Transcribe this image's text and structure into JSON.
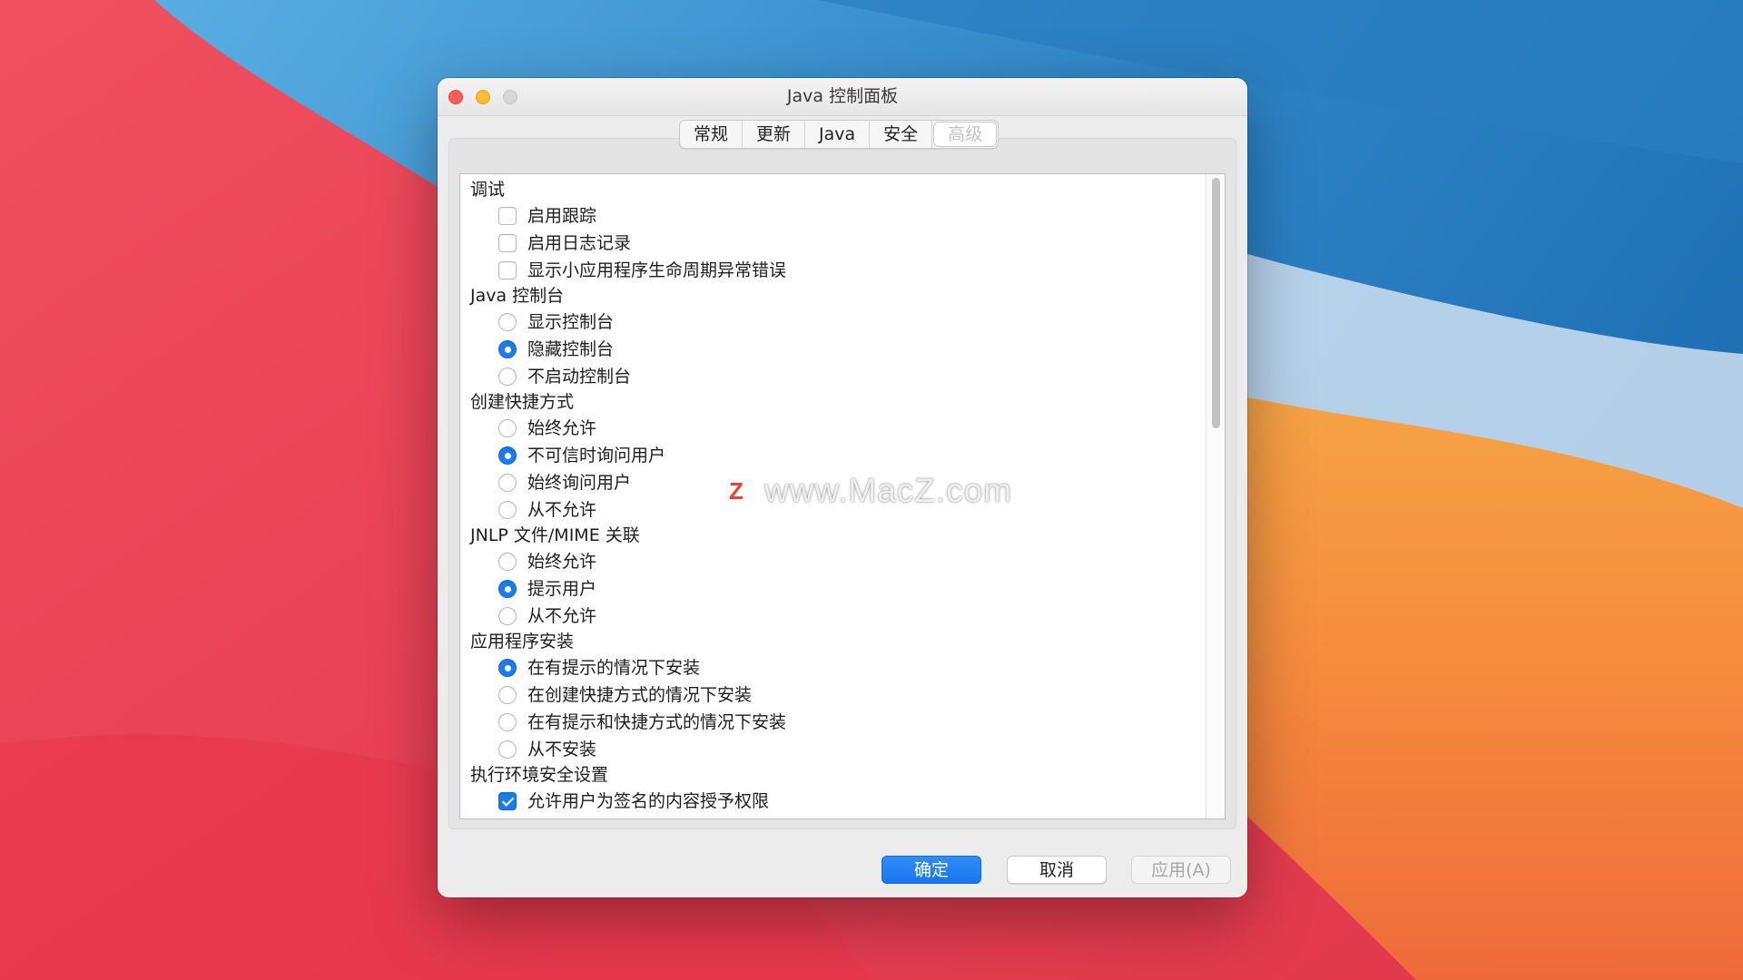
{
  "window": {
    "title": "Java 控制面板"
  },
  "tabs": [
    {
      "label": "常规",
      "active": false
    },
    {
      "label": "更新",
      "active": false
    },
    {
      "label": "Java",
      "active": false
    },
    {
      "label": "安全",
      "active": false
    },
    {
      "label": "高级",
      "active": true
    }
  ],
  "settings": {
    "debug": {
      "header": "调试",
      "items": [
        {
          "label": "启用跟踪",
          "checked": false
        },
        {
          "label": "启用日志记录",
          "checked": false
        },
        {
          "label": "显示小应用程序生命周期异常错误",
          "checked": false
        }
      ]
    },
    "console": {
      "header": "Java 控制台",
      "items": [
        {
          "label": "显示控制台",
          "selected": false
        },
        {
          "label": "隐藏控制台",
          "selected": true
        },
        {
          "label": "不启动控制台",
          "selected": false
        }
      ]
    },
    "shortcut": {
      "header": "创建快捷方式",
      "items": [
        {
          "label": "始终允许",
          "selected": false
        },
        {
          "label": "不可信时询问用户",
          "selected": true
        },
        {
          "label": "始终询问用户",
          "selected": false
        },
        {
          "label": "从不允许",
          "selected": false
        }
      ]
    },
    "jnlp": {
      "header": "JNLP 文件/MIME 关联",
      "items": [
        {
          "label": "始终允许",
          "selected": false
        },
        {
          "label": "提示用户",
          "selected": true
        },
        {
          "label": "从不允许",
          "selected": false
        }
      ]
    },
    "install": {
      "header": "应用程序安装",
      "items": [
        {
          "label": "在有提示的情况下安装",
          "selected": true
        },
        {
          "label": "在创建快捷方式的情况下安装",
          "selected": false
        },
        {
          "label": "在有提示和快捷方式的情况下安装",
          "selected": false
        },
        {
          "label": "从不安装",
          "selected": false
        }
      ]
    },
    "security": {
      "header": "执行环境安全设置",
      "items": [
        {
          "label": "允许用户为签名的内容授予权限",
          "checked": true
        }
      ]
    }
  },
  "buttons": {
    "ok": "确定",
    "cancel": "取消",
    "apply": "应用(A)"
  },
  "watermark": {
    "logo": "Z",
    "text": "www.MacZ.com"
  },
  "colors": {
    "accent": "#1a7cf0",
    "apply_disabled": "#a7a7a7"
  }
}
